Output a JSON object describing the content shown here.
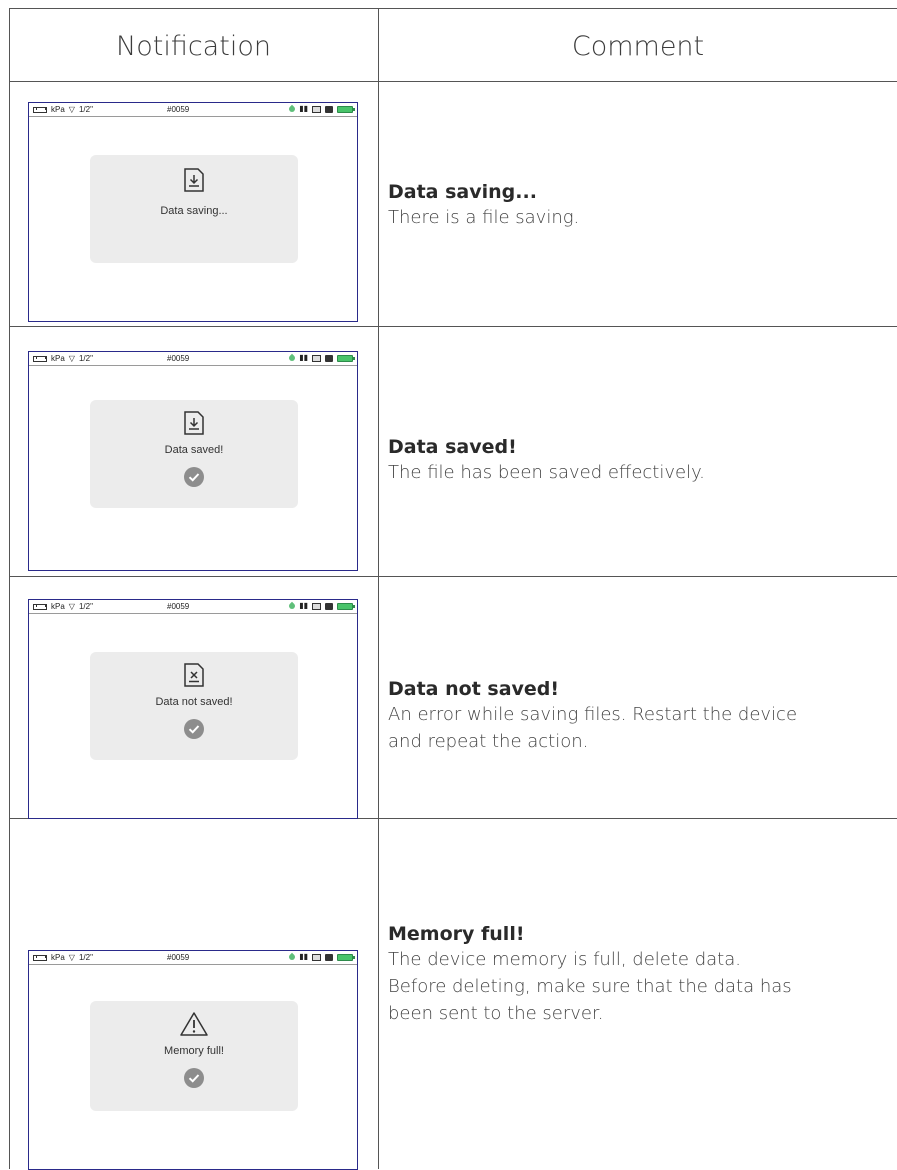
{
  "header": {
    "notification": "Notification",
    "comment": "Comment"
  },
  "status_bar": {
    "unit": "kPa",
    "filter": "1/2\"",
    "id": "#0059"
  },
  "rows": [
    {
      "dialog_text": "Data saving...",
      "icon": "file-download-icon",
      "check": false,
      "title": "Data saving...",
      "body": [
        "There is a file saving."
      ]
    },
    {
      "dialog_text": "Data saved!",
      "icon": "file-download-icon",
      "check": true,
      "title": "Data saved!",
      "body": [
        "The file has been saved effectively."
      ]
    },
    {
      "dialog_text": "Data not saved!",
      "icon": "file-error-icon",
      "check": true,
      "title": "Data not saved!",
      "body": [
        "An error while saving files. Restart the device",
        "and repeat the action."
      ]
    },
    {
      "dialog_text": "Memory full!",
      "icon": "warning-triangle-icon",
      "check": true,
      "title": "Memory full!",
      "body": [
        "The device memory is full, delete data.",
        "Before deleting, make sure that the data has",
        "been sent to the server."
      ]
    }
  ],
  "colors": {
    "battery": "#49c46a",
    "screen_border": "#2a2a8a",
    "dialog_bg": "#ececec"
  }
}
